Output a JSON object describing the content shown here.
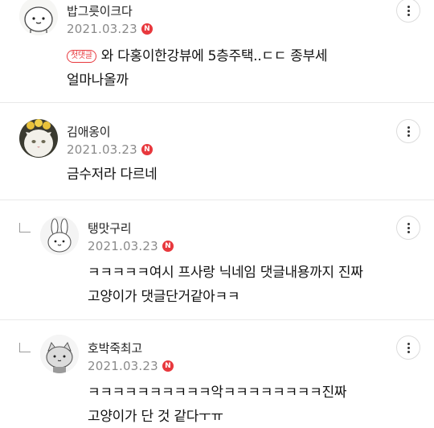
{
  "comments": [
    {
      "nickname": "밥그릇이크다",
      "date": "2021.03.23",
      "new_badge": "N",
      "first_badge": "첫댓글",
      "lines": [
        "와 다홍이한강뷰에 5층주택..ㄷㄷ 종부세",
        "얼마나올까"
      ],
      "is_reply": false
    },
    {
      "nickname": "김애옹이",
      "date": "2021.03.23",
      "new_badge": "N",
      "lines": [
        "금수저라 다르네"
      ],
      "is_reply": false
    },
    {
      "nickname": "탱맛구리",
      "date": "2021.03.23",
      "new_badge": "N",
      "lines": [
        "ㅋㅋㅋㅋㅋ여시 프사랑 닉네임 댓글내용까지 진짜",
        "고양이가 댓글단거같아ㅋㅋ"
      ],
      "is_reply": true
    },
    {
      "nickname": "호박죽최고",
      "date": "2021.03.23",
      "new_badge": "N",
      "lines": [
        "ㅋㅋㅋㅋㅋㅋㅋㅋㅋㅋ악ㅋㅋㅋㅋㅋㅋㅋㅋ진짜",
        "고양이가 단 것 같다ㅜㅠ"
      ],
      "is_reply": true
    }
  ],
  "colors": {
    "new_badge": "#e8383d",
    "date": "#8a8a8a",
    "divider": "#e9e9e9"
  },
  "icons": {
    "more": "more-vertical-icon",
    "reply": "reply-arrow-icon"
  }
}
